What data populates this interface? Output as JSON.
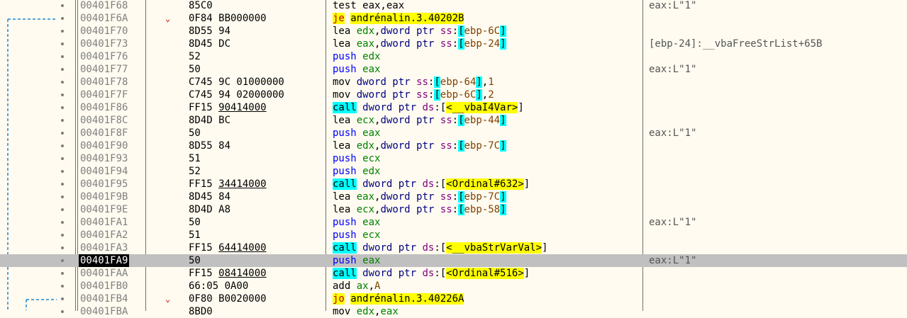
{
  "rows": [
    {
      "addr": "00401F68",
      "bytes": "85C0",
      "bytes_u": "",
      "bytes_tail": "",
      "instr": "test eax,eax",
      "comment": "eax:L\"1\"",
      "kind": "test",
      "jmark": ""
    },
    {
      "addr": "00401F6A",
      "bytes": "0F84 BB000000",
      "bytes_u": "",
      "bytes_tail": "",
      "mn": "je",
      "target": "andrénalin.3.40202B",
      "comment": "",
      "kind": "jmp",
      "jmark": "⌄"
    },
    {
      "addr": "00401F70",
      "bytes": "8D55 94",
      "mn": "lea",
      "reg": "edx",
      "ptrkw": "dword ptr",
      "seg": "ss",
      "mem": "ebp-6C",
      "comment": "",
      "kind": "lea"
    },
    {
      "addr": "00401F73",
      "bytes": "8D45 DC",
      "mn": "lea",
      "reg": "eax",
      "ptrkw": "dword ptr",
      "seg": "ss",
      "mem": "ebp-24",
      "comment": "[ebp-24]:__vbaFreeStrList+65B",
      "kind": "lea"
    },
    {
      "addr": "00401F76",
      "bytes": "52",
      "mn": "push",
      "reg": "edx",
      "comment": "",
      "kind": "push"
    },
    {
      "addr": "00401F77",
      "bytes": "50",
      "mn": "push",
      "reg": "eax",
      "comment": "eax:L\"1\"",
      "kind": "push"
    },
    {
      "addr": "00401F78",
      "bytes": "C745 9C 01000000",
      "mn": "mov",
      "ptrkw": "dword ptr",
      "seg": "ss",
      "mem": "ebp-64",
      "imm": "1",
      "comment": "",
      "kind": "movm"
    },
    {
      "addr": "00401F7F",
      "bytes": "C745 94 02000000",
      "mn": "mov",
      "ptrkw": "dword ptr",
      "seg": "ss",
      "mem": "ebp-6C",
      "imm": "2",
      "comment": "",
      "kind": "movm"
    },
    {
      "addr": "00401F86",
      "bytes_pre": "FF15 ",
      "bytes_u": "90414000",
      "mn": "call",
      "ptrkw": "dword ptr",
      "seg": "ds",
      "target": "<__vbaI4Var>",
      "comment": "",
      "kind": "call"
    },
    {
      "addr": "00401F8C",
      "bytes": "8D4D BC",
      "mn": "lea",
      "reg": "ecx",
      "ptrkw": "dword ptr",
      "seg": "ss",
      "mem": "ebp-44",
      "comment": "",
      "kind": "lea"
    },
    {
      "addr": "00401F8F",
      "bytes": "50",
      "mn": "push",
      "reg": "eax",
      "comment": "eax:L\"1\"",
      "kind": "push"
    },
    {
      "addr": "00401F90",
      "bytes": "8D55 84",
      "mn": "lea",
      "reg": "edx",
      "ptrkw": "dword ptr",
      "seg": "ss",
      "mem": "ebp-7C",
      "comment": "",
      "kind": "lea"
    },
    {
      "addr": "00401F93",
      "bytes": "51",
      "mn": "push",
      "reg": "ecx",
      "comment": "",
      "kind": "push"
    },
    {
      "addr": "00401F94",
      "bytes": "52",
      "mn": "push",
      "reg": "edx",
      "comment": "",
      "kind": "push"
    },
    {
      "addr": "00401F95",
      "bytes_pre": "FF15 ",
      "bytes_u": "34414000",
      "mn": "call",
      "ptrkw": "dword ptr",
      "seg": "ds",
      "target": "<Ordinal#632>",
      "comment": "",
      "kind": "call"
    },
    {
      "addr": "00401F9B",
      "bytes": "8D45 84",
      "mn": "lea",
      "reg": "eax",
      "ptrkw": "dword ptr",
      "seg": "ss",
      "mem": "ebp-7C",
      "comment": "",
      "kind": "lea"
    },
    {
      "addr": "00401F9E",
      "bytes": "8D4D A8",
      "mn": "lea",
      "reg": "ecx",
      "ptrkw": "dword ptr",
      "seg": "ss",
      "mem": "ebp-58",
      "comment": "",
      "kind": "lea"
    },
    {
      "addr": "00401FA1",
      "bytes": "50",
      "mn": "push",
      "reg": "eax",
      "comment": "eax:L\"1\"",
      "kind": "push"
    },
    {
      "addr": "00401FA2",
      "bytes": "51",
      "mn": "push",
      "reg": "ecx",
      "comment": "",
      "kind": "push"
    },
    {
      "addr": "00401FA3",
      "bytes_pre": "FF15 ",
      "bytes_u": "64414000",
      "mn": "call",
      "ptrkw": "dword ptr",
      "seg": "ds",
      "target": "<__vbaStrVarVal>",
      "comment": "",
      "kind": "call"
    },
    {
      "addr": "00401FA9",
      "bytes": "50",
      "mn": "push",
      "reg": "eax",
      "comment": "eax:L\"1\"",
      "kind": "push",
      "selected": true
    },
    {
      "addr": "00401FAA",
      "bytes_pre": "FF15 ",
      "bytes_u": "08414000",
      "mn": "call",
      "ptrkw": "dword ptr",
      "seg": "ds",
      "target": "<Ordinal#516>",
      "comment": "",
      "kind": "call"
    },
    {
      "addr": "00401FB0",
      "bytes": "66:05 0A00",
      "mn": "add",
      "reg": "ax",
      "imm": "A",
      "comment": "",
      "kind": "add"
    },
    {
      "addr": "00401FB4",
      "bytes": "0F80 B0020000",
      "mn": "jo",
      "target": "andrénalin.3.40226A",
      "comment": "",
      "kind": "jmp",
      "jmark": "⌄"
    },
    {
      "addr": "00401FBA",
      "bytes": "8BD0",
      "mn": "mov",
      "reg": "edx",
      "reg2": "eax",
      "comment": "",
      "kind": "movr"
    }
  ],
  "colors": {
    "background": "#fffbf0",
    "selection": "#c0c0c0",
    "highlight_yellow": "#ffff00",
    "highlight_cyan": "#00ffff",
    "arrow": "#0000ff",
    "jump_dashed": "#1e88d0"
  },
  "icons": {
    "ip_arrow": "instruction-pointer-arrow-icon",
    "branch": "branch-down-icon",
    "breakpoint_dot": "breakpoint-dot-icon"
  }
}
